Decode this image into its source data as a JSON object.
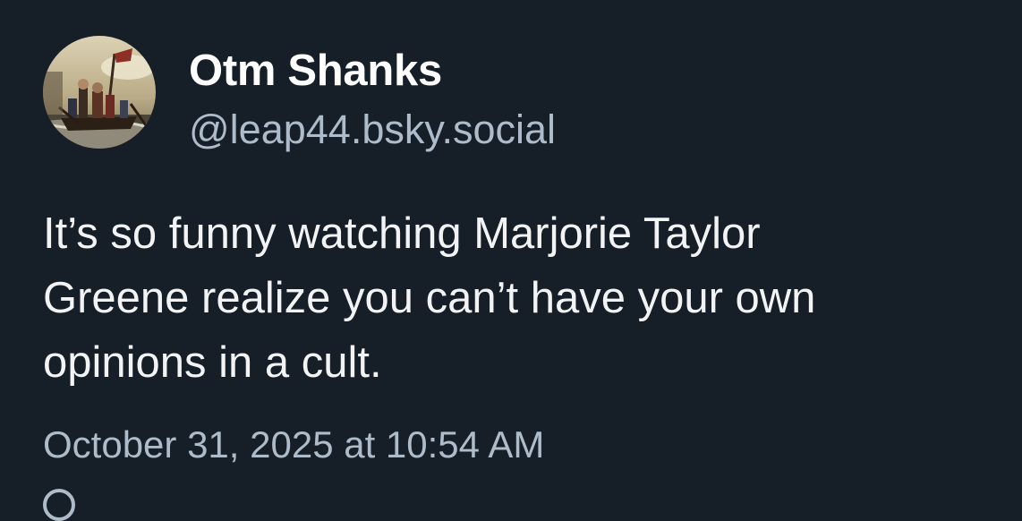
{
  "post": {
    "author": {
      "display_name": "Otm Shanks",
      "handle": "@leap44.bsky.social",
      "avatar_icon": "avatar-painting-icon"
    },
    "text_lines": [
      "It’s so funny watching Marjorie Taylor",
      "Greene realize you can’t have your own",
      "opinions in a cult."
    ],
    "timestamp": "October 31, 2025 at 10:54 AM"
  },
  "colors": {
    "background": "#161e27",
    "primary_text": "#f1f3f5",
    "secondary_text": "#aebbc9"
  }
}
